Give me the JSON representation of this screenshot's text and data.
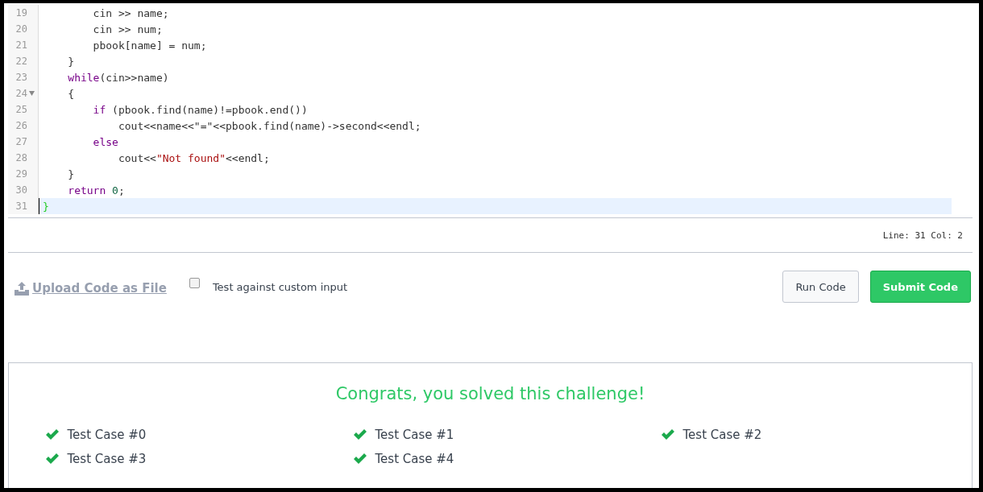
{
  "editor": {
    "lines": [
      {
        "number": "19",
        "foldable": false,
        "active": false,
        "tokens": [
          {
            "kind": "plain",
            "text": "        cin >> name;"
          }
        ]
      },
      {
        "number": "20",
        "foldable": false,
        "active": false,
        "tokens": [
          {
            "kind": "plain",
            "text": "        cin >> num;"
          }
        ]
      },
      {
        "number": "21",
        "foldable": false,
        "active": false,
        "tokens": [
          {
            "kind": "plain",
            "text": "        pbook[name] = num;"
          }
        ]
      },
      {
        "number": "22",
        "foldable": false,
        "active": false,
        "tokens": [
          {
            "kind": "plain",
            "text": "    }"
          }
        ]
      },
      {
        "number": "23",
        "foldable": false,
        "active": false,
        "tokens": [
          {
            "kind": "keyword",
            "text": "    while"
          },
          {
            "kind": "plain",
            "text": "(cin>>name)"
          }
        ]
      },
      {
        "number": "24",
        "foldable": true,
        "active": false,
        "tokens": [
          {
            "kind": "plain",
            "text": "    {"
          }
        ]
      },
      {
        "number": "25",
        "foldable": false,
        "active": false,
        "tokens": [
          {
            "kind": "keyword",
            "text": "        if"
          },
          {
            "kind": "plain",
            "text": " (pbook.find(name)!=pbook.end())"
          }
        ]
      },
      {
        "number": "26",
        "foldable": false,
        "active": false,
        "tokens": [
          {
            "kind": "plain",
            "text": "            cout<<name<<\"=\"<<pbook.find(name)->second<<endl;"
          }
        ]
      },
      {
        "number": "27",
        "foldable": false,
        "active": false,
        "tokens": [
          {
            "kind": "keyword",
            "text": "        else"
          }
        ]
      },
      {
        "number": "28",
        "foldable": false,
        "active": false,
        "tokens": [
          {
            "kind": "plain",
            "text": "            cout<<"
          },
          {
            "kind": "string",
            "text": "\"Not found\""
          },
          {
            "kind": "plain",
            "text": "<<endl;"
          }
        ]
      },
      {
        "number": "29",
        "foldable": false,
        "active": false,
        "tokens": [
          {
            "kind": "plain",
            "text": "    }"
          }
        ]
      },
      {
        "number": "30",
        "foldable": false,
        "active": false,
        "tokens": [
          {
            "kind": "keyword",
            "text": "    return"
          },
          {
            "kind": "number",
            "text": " 0"
          },
          {
            "kind": "plain",
            "text": ";"
          }
        ]
      },
      {
        "number": "31",
        "foldable": false,
        "active": true,
        "tokens": [
          {
            "kind": "bracket",
            "text": "}"
          }
        ]
      }
    ],
    "cursor_position": "Line: 31 Col: 2"
  },
  "toolbar": {
    "upload_link": "Upload Code as File",
    "custom_input": {
      "label": "Test against custom input",
      "checked": false
    },
    "buttons": [
      {
        "label": "Run Code",
        "kind": "secondary"
      },
      {
        "label": "Submit Code",
        "kind": "primary"
      }
    ]
  },
  "result": {
    "title": "Congrats, you solved this challenge!",
    "test_cases": [
      {
        "label": "Test Case #0",
        "passed": true
      },
      {
        "label": "Test Case #1",
        "passed": true
      },
      {
        "label": "Test Case #2",
        "passed": true
      },
      {
        "label": "Test Case #3",
        "passed": true
      },
      {
        "label": "Test Case #4",
        "passed": true
      }
    ]
  }
}
